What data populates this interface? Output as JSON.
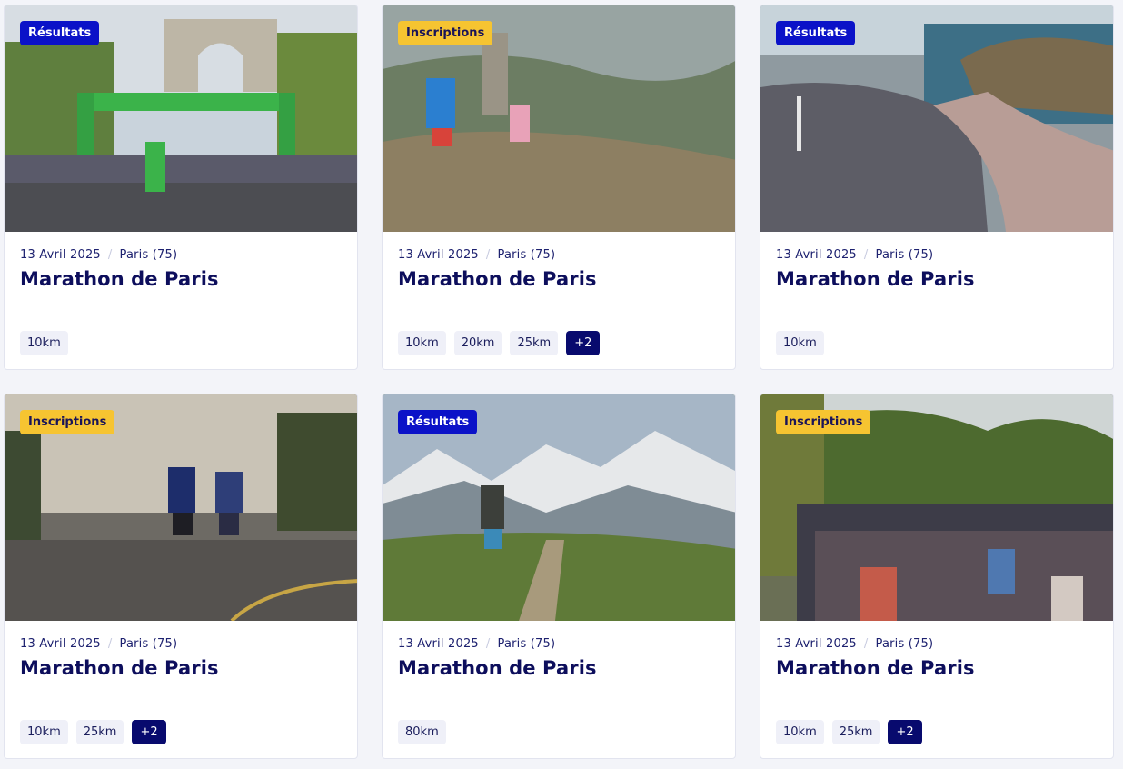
{
  "cards": [
    {
      "status": "Résultats",
      "date": "13 Avril 2025",
      "location": "Paris (75)",
      "title": "Marathon de Paris",
      "distances": [
        "10km"
      ],
      "more": ""
    },
    {
      "status": "Inscriptions",
      "date": "13 Avril 2025",
      "location": "Paris (75)",
      "title": "Marathon de Paris",
      "distances": [
        "10km",
        "20km",
        "25km"
      ],
      "more": "+2"
    },
    {
      "status": "Résultats",
      "date": "13 Avril 2025",
      "location": "Paris (75)",
      "title": "Marathon de Paris",
      "distances": [
        "10km"
      ],
      "more": ""
    },
    {
      "status": "Inscriptions",
      "date": "13 Avril 2025",
      "location": "Paris (75)",
      "title": "Marathon de Paris",
      "distances": [
        "10km",
        "25km"
      ],
      "more": "+2"
    },
    {
      "status": "Résultats",
      "date": "13 Avril 2025",
      "location": "Paris (75)",
      "title": "Marathon de Paris",
      "distances": [
        "80km"
      ],
      "more": ""
    },
    {
      "status": "Inscriptions",
      "date": "13 Avril 2025",
      "location": "Paris (75)",
      "title": "Marathon de Paris",
      "distances": [
        "10km",
        "25km"
      ],
      "more": "+2"
    }
  ],
  "colors": {
    "results_badge": "#0b12c8",
    "inscriptions_badge": "#f6c431",
    "title_text": "#0d0e5c",
    "more_tag": "#080a6e"
  }
}
